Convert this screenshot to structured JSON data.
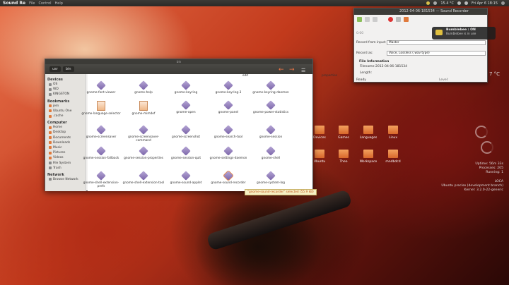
{
  "top_panel": {
    "app_name": "Sound Re",
    "menus": [
      "File",
      "Control",
      "Help"
    ],
    "clock": "Fri Apr 6 18:15",
    "temp_indicator": "15.4 °C"
  },
  "file_manager": {
    "title": "bin",
    "path": [
      "usr",
      "bin"
    ],
    "sidebar": {
      "devices_header": "Devices",
      "devices": [
        "OS",
        "WD",
        "KINGSTON"
      ],
      "bookmarks_header": "Bookmarks",
      "bookmarks": [
        "jem",
        "Ubuntu One",
        ".cache"
      ],
      "computer_header": "Computer",
      "computer": [
        "Home",
        "Desktop",
        "Documents",
        "Downloads",
        "Music",
        "Pictures",
        "Videos",
        "File System",
        "Trash"
      ],
      "network_header": "Network",
      "network": [
        "Browse Network"
      ]
    },
    "top_partial_labels": [
      "edit",
      "properties"
    ],
    "files": [
      "gnome-font-viewer",
      "gnome-help",
      "gnome-keyring",
      "gnome-keyring-3",
      "gnome-keyring-daemon",
      "gnome-language-selector",
      "gnome-mimdef",
      "gnome-open",
      "gnome-panel",
      "gnome-power-statistics",
      "gnome-screensaver",
      "gnome-screensaver-command",
      "gnome-screenshot",
      "gnome-search-tool",
      "gnome-session",
      "gnome-session-fallback",
      "gnome-session-properties",
      "gnome-session-quit",
      "gnome-settings-daemon",
      "gnome-shell",
      "gnome-shell-extension-prefs",
      "gnome-shell-extension-tool",
      "gnome-sound-applet",
      "gnome-sound-recorder",
      "gnome-system-log"
    ],
    "selected": "gnome-sound-recorder",
    "status_text": "\"gnome-sound-recorder\" selected (55.9 kB)"
  },
  "sound_recorder": {
    "title": "2012-04-06-181534 — Sound Recorder",
    "position_label": "0:00",
    "record_from_label": "Record from input:",
    "record_from_value": "Master",
    "record_as_label": "Record as:",
    "record_as_value": "Voice, Lossless (.wav type)",
    "info_header": "File Information",
    "filename_label": "Filename:",
    "filename_value": "2012-04-06-181534",
    "length_label": "Length:",
    "status": "Ready",
    "level_label": "Level:"
  },
  "notification": {
    "title": "Bumblebee : ON",
    "body": "Bumblebee is in use"
  },
  "desktop_folders": [
    "Devices",
    "Games",
    "Languages",
    "Linux",
    "Ubuntu",
    "Theo",
    "Workspace",
    "mndbdcd"
  ],
  "conky": {
    "temp": "7 °C",
    "uptime": "Uptime: 56m 33s",
    "processes": "Processes: 205",
    "running": "Running: 1",
    "distro": "Ubuntu precise (development branch)",
    "kernel": "Kernel: 3.2.0-22-generic",
    "hostname": "LOCA"
  },
  "colors": {
    "accent": "#e07a3c",
    "panel": "#3c3b37",
    "status_text": "#c0541d"
  }
}
